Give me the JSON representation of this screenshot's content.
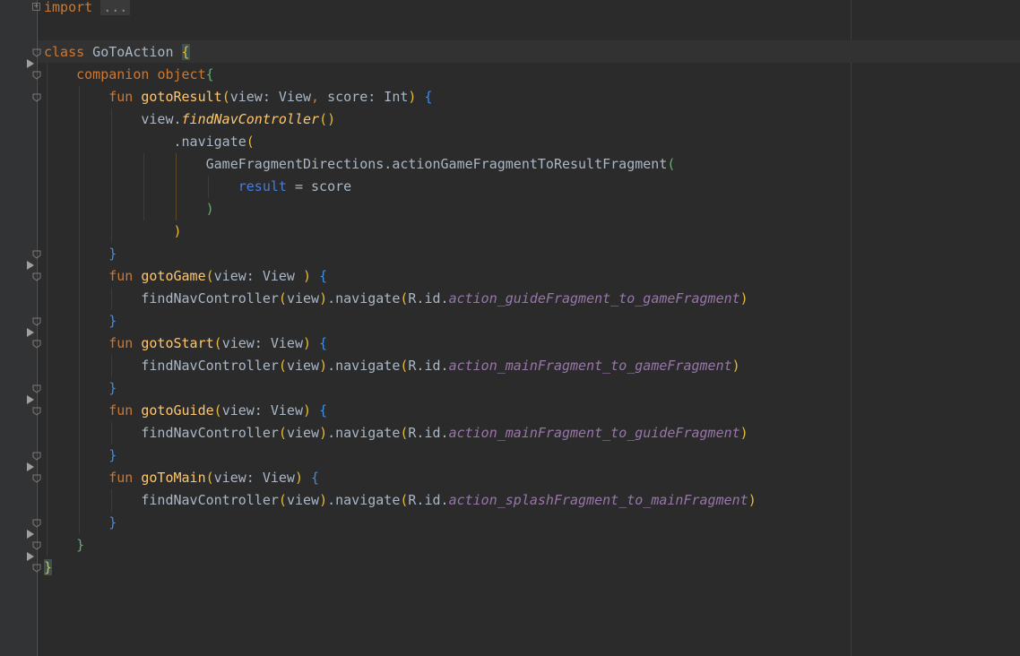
{
  "editor": {
    "lines": [
      [
        {
          "t": "import",
          "c": "kw"
        },
        {
          "t": " "
        },
        {
          "t": "...",
          "c": "folded"
        }
      ],
      [],
      [
        {
          "t": "class",
          "c": "kw"
        },
        {
          "t": " GoToAction "
        },
        {
          "t": "{",
          "c": "b1 bm"
        }
      ],
      [
        {
          "t": "    "
        },
        {
          "t": "companion",
          "c": "kw"
        },
        {
          "t": " "
        },
        {
          "t": "object",
          "c": "kw"
        },
        {
          "t": "{",
          "c": "b2"
        }
      ],
      [
        {
          "t": "        "
        },
        {
          "t": "fun",
          "c": "kw"
        },
        {
          "t": " "
        },
        {
          "t": "gotoResult",
          "c": "fn"
        },
        {
          "t": "(",
          "c": "b1"
        },
        {
          "t": "view: View"
        },
        {
          "t": ",",
          "c": "kw"
        },
        {
          "t": " score: Int"
        },
        {
          "t": ")",
          "c": "b1"
        },
        {
          "t": " "
        },
        {
          "t": "{",
          "c": "b3"
        }
      ],
      [
        {
          "t": "            view."
        },
        {
          "t": "findNavController",
          "c": "fn it"
        },
        {
          "t": "()",
          "c": "b1"
        }
      ],
      [
        {
          "t": "                .navigate"
        },
        {
          "t": "(",
          "c": "b1"
        }
      ],
      [
        {
          "t": "                    GameFragmentDirections.actionGameFragmentToResultFragment"
        },
        {
          "t": "(",
          "c": "b2"
        }
      ],
      [
        {
          "t": "                        "
        },
        {
          "t": "result",
          "c": "named"
        },
        {
          "t": " = score"
        }
      ],
      [
        {
          "t": "                    "
        },
        {
          "t": ")",
          "c": "b2"
        }
      ],
      [
        {
          "t": "                "
        },
        {
          "t": ")",
          "c": "b1"
        }
      ],
      [
        {
          "t": "        "
        },
        {
          "t": "}",
          "c": "b3"
        }
      ],
      [
        {
          "t": "        "
        },
        {
          "t": "fun",
          "c": "kw"
        },
        {
          "t": " "
        },
        {
          "t": "gotoGame",
          "c": "fn"
        },
        {
          "t": "(",
          "c": "b1"
        },
        {
          "t": "view: View "
        },
        {
          "t": ")",
          "c": "b1"
        },
        {
          "t": " "
        },
        {
          "t": "{",
          "c": "b3"
        }
      ],
      [
        {
          "t": "            findNavController"
        },
        {
          "t": "(",
          "c": "b1"
        },
        {
          "t": "view"
        },
        {
          "t": ")",
          "c": "b1"
        },
        {
          "t": ".navigate"
        },
        {
          "t": "(",
          "c": "b1"
        },
        {
          "t": "R.id."
        },
        {
          "t": "action_guideFragment_to_gameFragment",
          "c": "field"
        },
        {
          "t": ")",
          "c": "b1"
        }
      ],
      [
        {
          "t": "        "
        },
        {
          "t": "}",
          "c": "b3"
        }
      ],
      [
        {
          "t": "        "
        },
        {
          "t": "fun",
          "c": "kw"
        },
        {
          "t": " "
        },
        {
          "t": "gotoStart",
          "c": "fn"
        },
        {
          "t": "(",
          "c": "b1"
        },
        {
          "t": "view: View"
        },
        {
          "t": ")",
          "c": "b1"
        },
        {
          "t": " "
        },
        {
          "t": "{",
          "c": "b3"
        }
      ],
      [
        {
          "t": "            findNavController"
        },
        {
          "t": "(",
          "c": "b1"
        },
        {
          "t": "view"
        },
        {
          "t": ")",
          "c": "b1"
        },
        {
          "t": ".navigate"
        },
        {
          "t": "(",
          "c": "b1"
        },
        {
          "t": "R.id."
        },
        {
          "t": "action_mainFragment_to_gameFragment",
          "c": "field"
        },
        {
          "t": ")",
          "c": "b1"
        }
      ],
      [
        {
          "t": "        "
        },
        {
          "t": "}",
          "c": "b3"
        }
      ],
      [
        {
          "t": "        "
        },
        {
          "t": "fun",
          "c": "kw"
        },
        {
          "t": " "
        },
        {
          "t": "gotoGuide",
          "c": "fn"
        },
        {
          "t": "(",
          "c": "b1"
        },
        {
          "t": "view: View"
        },
        {
          "t": ")",
          "c": "b1"
        },
        {
          "t": " "
        },
        {
          "t": "{",
          "c": "b3"
        }
      ],
      [
        {
          "t": "            findNavController"
        },
        {
          "t": "(",
          "c": "b1"
        },
        {
          "t": "view"
        },
        {
          "t": ")",
          "c": "b1"
        },
        {
          "t": ".navigate"
        },
        {
          "t": "(",
          "c": "b1"
        },
        {
          "t": "R.id."
        },
        {
          "t": "action_mainFragment_to_guideFragment",
          "c": "field"
        },
        {
          "t": ")",
          "c": "b1"
        }
      ],
      [
        {
          "t": "        "
        },
        {
          "t": "}",
          "c": "b3"
        }
      ],
      [
        {
          "t": "        "
        },
        {
          "t": "fun",
          "c": "kw"
        },
        {
          "t": " "
        },
        {
          "t": "goToMain",
          "c": "fn"
        },
        {
          "t": "(",
          "c": "b1"
        },
        {
          "t": "view: View"
        },
        {
          "t": ")",
          "c": "b1"
        },
        {
          "t": " "
        },
        {
          "t": "{",
          "c": "b3"
        }
      ],
      [
        {
          "t": "            findNavController"
        },
        {
          "t": "(",
          "c": "b1"
        },
        {
          "t": "view"
        },
        {
          "t": ")",
          "c": "b1"
        },
        {
          "t": ".navigate"
        },
        {
          "t": "(",
          "c": "b1"
        },
        {
          "t": "R.id."
        },
        {
          "t": "action_splashFragment_to_mainFragment",
          "c": "field"
        },
        {
          "t": ")",
          "c": "b1"
        }
      ],
      [
        {
          "t": "        "
        },
        {
          "t": "}",
          "c": "b3"
        }
      ],
      [
        {
          "t": "    "
        },
        {
          "t": "}",
          "c": "b2"
        }
      ],
      [
        {
          "t": "}",
          "c": "b1 bm"
        }
      ]
    ]
  },
  "colors": {
    "background": "#2b2b2b",
    "keyword": "#cc7832",
    "function": "#ffc66d",
    "field": "#9876aa",
    "named_arg": "#467cda",
    "bracket_level1": "#e8ba36",
    "bracket_level2": "#6aab73",
    "bracket_level3": "#3d8ee6"
  }
}
